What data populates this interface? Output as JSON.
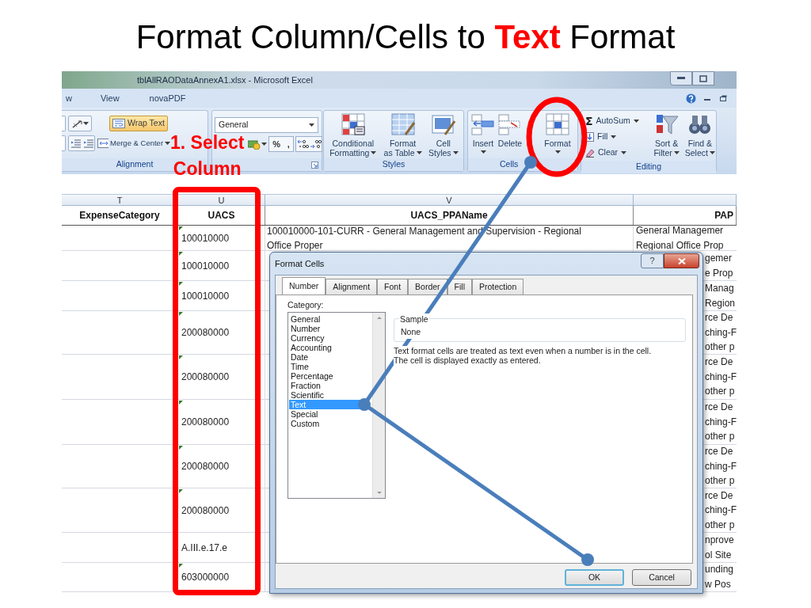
{
  "slide_title": "Format Column/Cells to **Text** Format",
  "window": {
    "title": "tblAllRAODataAnnexA1.xlsx - Microsoft Excel"
  },
  "ribbon_tabs": [
    {
      "label": "w",
      "selected": false
    },
    {
      "label": "View",
      "selected": false
    },
    {
      "label": "novaPDF",
      "selected": false
    }
  ],
  "alignment": {
    "label": "Alignment",
    "wrap_text": {
      "label": "Wrap Text",
      "on": true
    },
    "merge": {
      "label": "Merge & Center",
      "dropdown": true
    }
  },
  "number": {
    "format": "General",
    "symbols": [
      "%",
      ","
    ]
  },
  "styles": {
    "label": "Styles",
    "buttons": [
      {
        "kind": "conditional",
        "lines": [
          "Conditional",
          "Formatting"
        ],
        "dropdown": true
      },
      {
        "kind": "table",
        "lines": [
          "Format",
          "as Table"
        ],
        "dropdown": true
      },
      {
        "kind": "cellstyles",
        "lines": [
          "Cell",
          "Styles"
        ],
        "dropdown": true
      }
    ]
  },
  "cells": {
    "label": "Cells",
    "buttons": [
      {
        "kind": "insert",
        "lines": [
          "Insert"
        ],
        "dropdown": true
      },
      {
        "kind": "delete",
        "lines": [
          "Delete"
        ],
        "dropdown": false
      },
      {
        "kind": "format",
        "lines": [
          "Format"
        ],
        "dropdown": true
      }
    ]
  },
  "editing": {
    "label": "Editing",
    "small_buttons": [
      {
        "kind": "autosum",
        "icon_char": "Σ",
        "label": "AutoSum",
        "dropdown": true
      },
      {
        "kind": "fill",
        "label": "Fill",
        "dropdown": true
      },
      {
        "kind": "clear",
        "label": "Clear",
        "dropdown": true
      }
    ],
    "buttons": [
      {
        "kind": "sort",
        "lines": [
          "Sort &",
          "Filter"
        ],
        "dropdown": true
      },
      {
        "kind": "find",
        "lines": [
          "Find &",
          "Select"
        ],
        "dropdown": true
      }
    ]
  },
  "sheet": {
    "column_letters": [
      "T",
      "U",
      "V"
    ],
    "headers": [
      "ExpenseCategory",
      "UACS",
      "UACS_PPAName",
      "PAP"
    ],
    "rows": [
      {
        "uacs": "100010000",
        "flag": true,
        "ppa": [
          "100010000-101-CURR - General Management and Supervision - Regional",
          "Office Proper"
        ],
        "pap": [
          "General Managemer",
          "Regional Office Prop"
        ]
      },
      {
        "uacs": "100010000",
        "flag": true,
        "pap": [
          "gemer",
          "e Prop"
        ]
      },
      {
        "uacs": "100010000",
        "flag": true,
        "pap": [
          "Manag",
          "Region"
        ]
      },
      {
        "uacs": "200080000",
        "flag": true,
        "pap": [
          "rce De",
          "ching-F",
          "other p"
        ]
      },
      {
        "uacs": "200080000",
        "flag": true,
        "pap": [
          "rce De",
          "ching-F",
          "other p"
        ]
      },
      {
        "uacs": "200080000",
        "flag": true,
        "pap": [
          "rce De",
          "ching-F",
          "other p"
        ]
      },
      {
        "uacs": "200080000",
        "flag": true,
        "pap": [
          "rce De",
          "ching-F",
          "other p"
        ]
      },
      {
        "uacs": "200080000",
        "flag": true,
        "pap": [
          "rce De",
          "ching-F",
          "other p"
        ]
      },
      {
        "uacs": "A.III.e.17.e",
        "flag": false,
        "pap": [
          "nprove",
          "ol Site"
        ]
      },
      {
        "uacs": "603000000",
        "flag": true,
        "pap": [
          "unding",
          "w Pos"
        ]
      }
    ]
  },
  "dialog": {
    "title": "Format Cells",
    "help": "?",
    "tabs": [
      {
        "label": "Number",
        "selected": true
      },
      {
        "label": "Alignment",
        "selected": false
      },
      {
        "label": "Font",
        "selected": false
      },
      {
        "label": "Border",
        "selected": false
      },
      {
        "label": "Fill",
        "selected": false
      },
      {
        "label": "Protection",
        "selected": false
      }
    ],
    "category_label": "Category:",
    "categories": [
      {
        "label": "General",
        "selected": false
      },
      {
        "label": "Number",
        "selected": false
      },
      {
        "label": "Currency",
        "selected": false
      },
      {
        "label": "Accounting",
        "selected": false
      },
      {
        "label": "Date",
        "selected": false
      },
      {
        "label": "Time",
        "selected": false
      },
      {
        "label": "Percentage",
        "selected": false
      },
      {
        "label": "Fraction",
        "selected": false
      },
      {
        "label": "Scientific",
        "selected": false
      },
      {
        "label": "Text",
        "selected": true
      },
      {
        "label": "Special",
        "selected": false
      },
      {
        "label": "Custom",
        "selected": false
      }
    ],
    "sample_label": "Sample",
    "sample_value": "None",
    "description": [
      "Text format cells are treated as text even when a number is in the cell.",
      "The cell is displayed exactly as entered."
    ],
    "buttons": [
      {
        "label": "OK",
        "default": true
      },
      {
        "label": "Cancel",
        "default": false
      }
    ]
  },
  "callout": {
    "lines": [
      "1. Select",
      "Column"
    ]
  }
}
